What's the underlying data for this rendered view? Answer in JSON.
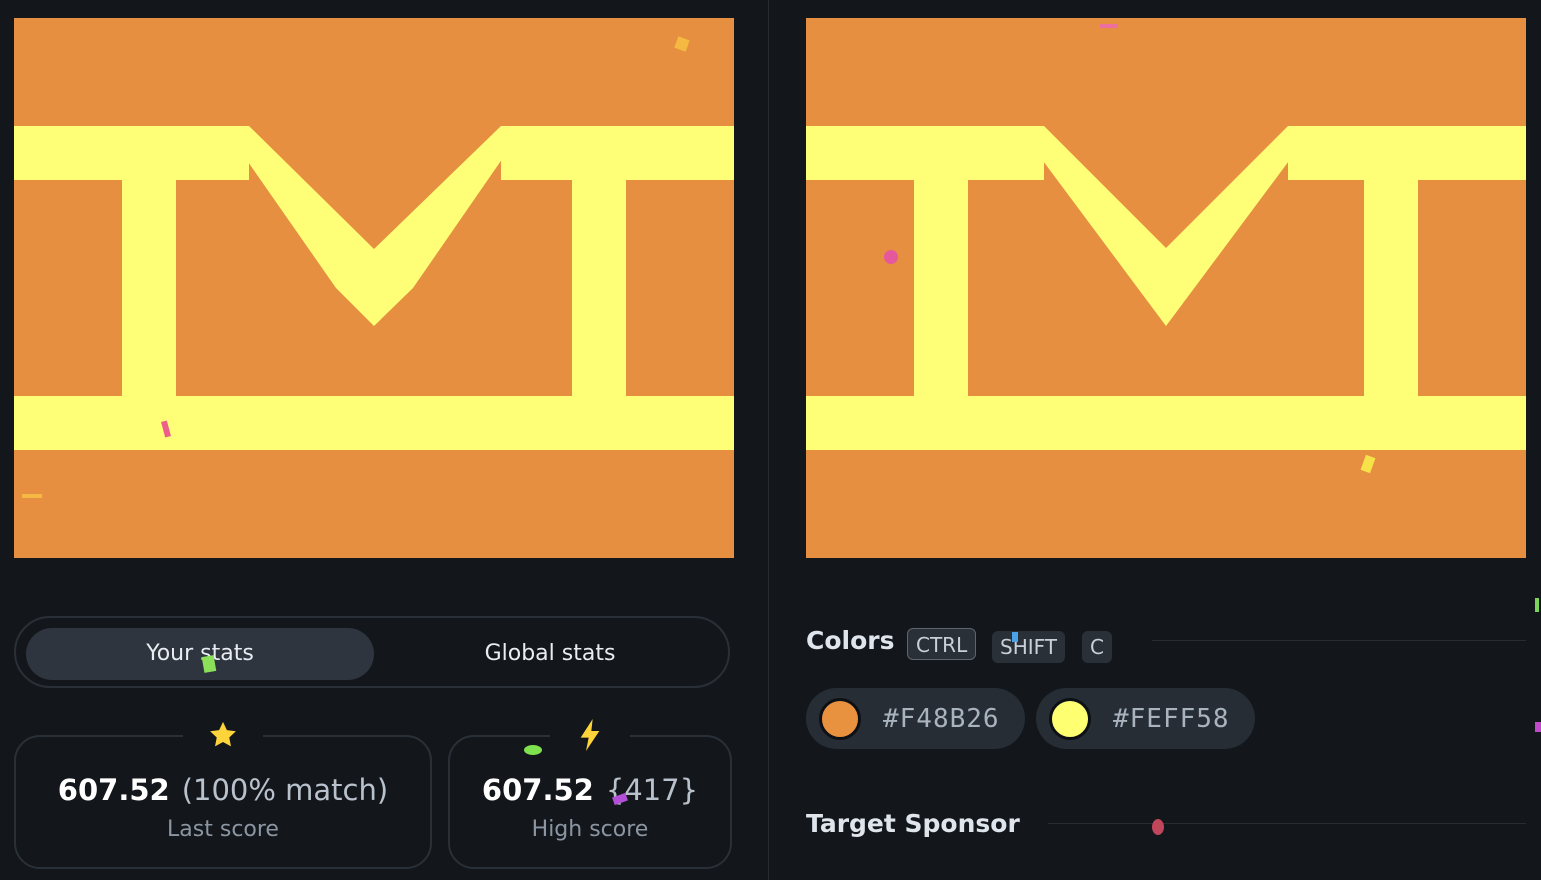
{
  "stats_tabs": {
    "your_stats": "Your stats",
    "global_stats": "Global stats"
  },
  "last_score": {
    "value": "607.52",
    "match": "(100% match)",
    "label": "Last score"
  },
  "high_score": {
    "value": "607.52",
    "rank": "{417}",
    "label": "High score"
  },
  "colors_section": {
    "title": "Colors",
    "shortcut_keys": [
      "CTRL",
      "SHIFT",
      "C"
    ],
    "swatches": [
      {
        "hex": "#F48B26",
        "swatch_color": "#e8913f"
      },
      {
        "hex": "#FEFF58",
        "swatch_color": "#ffff72"
      }
    ]
  },
  "sponsor_section": {
    "title": "Target Sponsor"
  },
  "palette": {
    "background": "#13171c",
    "canvas_orange": "#e68f40",
    "canvas_yellow": "#ffff77"
  },
  "icons": {
    "last_score": "star-icon",
    "high_score": "lightning-icon"
  }
}
